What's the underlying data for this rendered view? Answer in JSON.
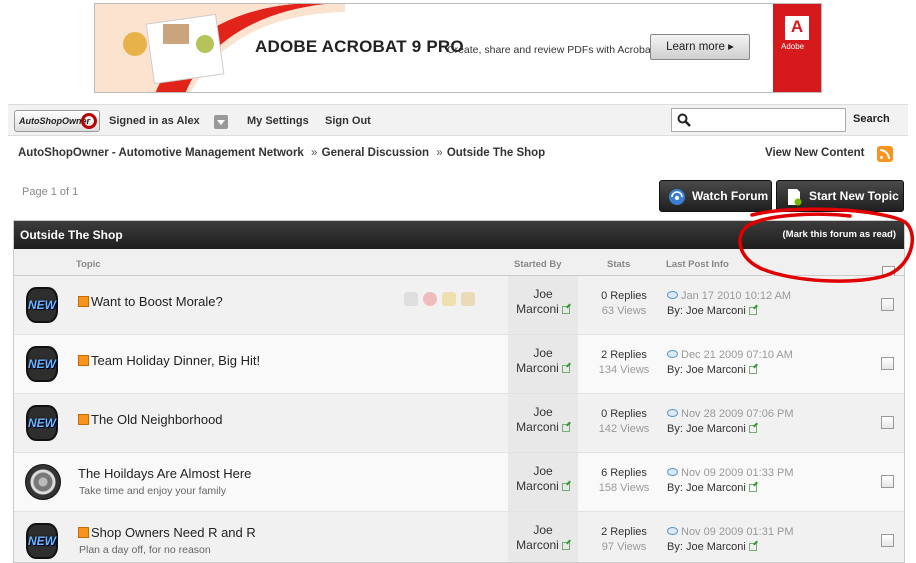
{
  "banner": {
    "product": "ADOBE ACROBAT 9 PRO",
    "tagline": "Create, share and review PDFs with Acrobat 9",
    "cta": "Learn more ▸",
    "brand": "Adobe"
  },
  "userbar": {
    "logo_text": "AutoShopOwner",
    "signed_in": "Signed in as Alex",
    "settings": "My Settings",
    "signout": "Sign Out",
    "search_placeholder": "",
    "search_label": "Search"
  },
  "breadcrumb": {
    "items": [
      "AutoShopOwner - Automotive Management Network",
      "General Discussion",
      "Outside The Shop"
    ],
    "separator": "»"
  },
  "view_new_content": "View New Content",
  "page_info": "Page 1 of 1",
  "buttons": {
    "watch": "Watch Forum",
    "start": "Start New Topic"
  },
  "forum": {
    "title": "Outside The Shop",
    "mark_read": "(Mark this forum as read)",
    "columns": {
      "topic": "Topic",
      "started_by": "Started By",
      "stats": "Stats",
      "last_post": "Last Post Info"
    },
    "rows": [
      {
        "badge": "NEW",
        "title": "Want to Boost Morale?",
        "desc": "",
        "author_first": "Joe",
        "author_last": "Marconi",
        "replies": "0 Replies",
        "views": "63 Views",
        "date": "Jan 17 2010 10:12 AM",
        "by": "By: Joe Marconi"
      },
      {
        "badge": "NEW",
        "title": "Team Holiday Dinner, Big Hit!",
        "desc": "",
        "author_first": "Joe",
        "author_last": "Marconi",
        "replies": "2 Replies",
        "views": "134 Views",
        "date": "Dec 21 2009 07:10 AM",
        "by": "By: Joe Marconi"
      },
      {
        "badge": "NEW",
        "title": "The Old Neighborhood",
        "desc": "",
        "author_first": "Joe",
        "author_last": "Marconi",
        "replies": "0 Replies",
        "views": "142 Views",
        "date": "Nov 28 2009 07:06 PM",
        "by": "By: Joe Marconi"
      },
      {
        "badge": "",
        "title": "The Hoildays Are Almost Here",
        "desc": "Take time and enjoy your family",
        "author_first": "Joe",
        "author_last": "Marconi",
        "replies": "6 Replies",
        "views": "158 Views",
        "date": "Nov 09 2009 01:33 PM",
        "by": "By: Joe Marconi"
      },
      {
        "badge": "NEW",
        "title": "Shop Owners Need R and R",
        "desc": "Plan a day off, for no reason",
        "author_first": "Joe",
        "author_last": "Marconi",
        "replies": "2 Replies",
        "views": "97 Views",
        "date": "Nov 09 2009 01:31 PM",
        "by": "By: Joe Marconi"
      }
    ]
  },
  "colors": {
    "header_dark": "#1d1d1d",
    "annotation_red": "#e00000",
    "rss_orange": "#f7941d"
  }
}
